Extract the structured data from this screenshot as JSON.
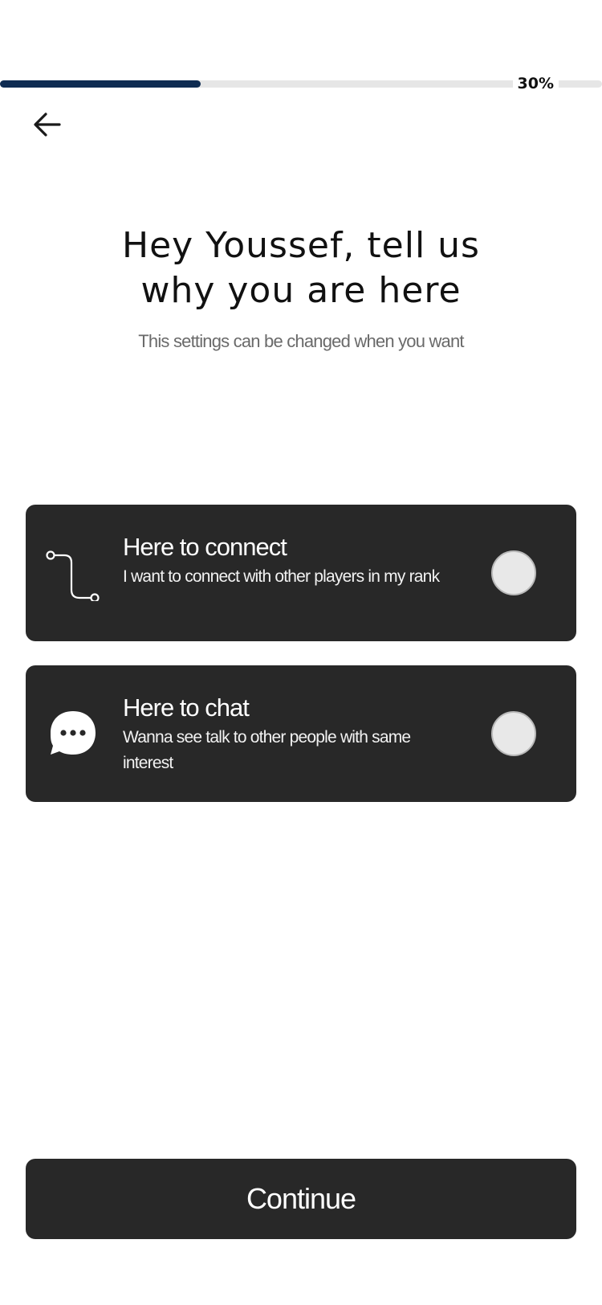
{
  "progress": {
    "value_percent": 30,
    "label": "30%",
    "fill_color": "#0f2c52",
    "track_color": "#e6e6e6"
  },
  "nav": {
    "back_icon": "arrow-left-icon"
  },
  "header": {
    "title_line1": "Hey Youssef, tell us",
    "title_line2": "why you are here",
    "subtitle": "This settings can be changed when you want"
  },
  "options": [
    {
      "icon": "route-icon",
      "title": "Here to connect",
      "description": "I want to connect with other players in my rank",
      "selected": false
    },
    {
      "icon": "chat-bubble-icon",
      "title": "Here to chat",
      "description": "Wanna see talk to other people with same interest",
      "selected": false
    }
  ],
  "actions": {
    "continue_label": "Continue"
  },
  "colors": {
    "card_background": "#282828",
    "primary_button": "#282828",
    "radio_fill": "#e8e8e8"
  }
}
